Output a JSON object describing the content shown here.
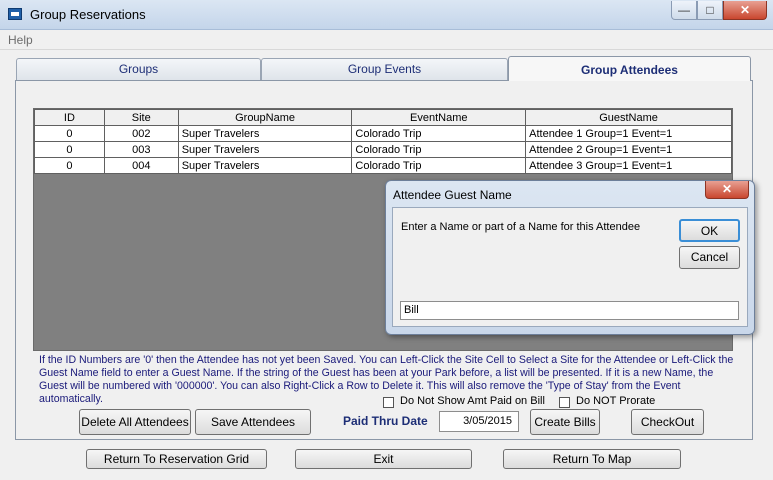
{
  "window": {
    "title": "Group Reservations"
  },
  "menu": {
    "help": "Help"
  },
  "tabs": [
    {
      "label": "Groups"
    },
    {
      "label": "Group Events"
    },
    {
      "label": "Group Attendees"
    }
  ],
  "grid": {
    "columns": [
      "ID",
      "Site",
      "GroupName",
      "EventName",
      "GuestName"
    ],
    "rows": [
      [
        "0",
        "002",
        "Super Travelers",
        "Colorado Trip",
        "Attendee 1 Group=1 Event=1"
      ],
      [
        "0",
        "003",
        "Super Travelers",
        "Colorado Trip",
        "Attendee 2 Group=1 Event=1"
      ],
      [
        "0",
        "004",
        "Super Travelers",
        "Colorado Trip",
        "Attendee 3 Group=1 Event=1"
      ]
    ]
  },
  "dialog": {
    "title": "Attendee Guest Name",
    "prompt": "Enter a Name or part of a Name for this Attendee",
    "ok_label": "OK",
    "cancel_label": "Cancel",
    "input_value": "Bill"
  },
  "info": {
    "text": "If the ID Numbers are '0' then the Attendee has not yet been Saved. You can Left-Click the Site Cell to Select a Site for the Attendee or Left-Click the Guest Name field to enter a Guest Name.  If the string of the Guest has been at your Park before, a list will be presented.  If it is a new Name, the Guest will be numbered with '000000'.  You can also Right-Click a Row to Delete it.  This will also remove the 'Type of Stay' from the Event automatically."
  },
  "options": {
    "no_amt_paid_label": "Do Not Show Amt Paid on Bill",
    "no_prorate_label": "Do NOT Prorate"
  },
  "actions": {
    "delete_all_label": "Delete All Attendees",
    "save_label": "Save Attendees",
    "paid_thru_label": "Paid Thru Date",
    "paid_thru_value": "3/05/2015",
    "create_bills_label": "Create Bills",
    "checkout_label": "CheckOut"
  },
  "footer": {
    "return_grid_label": "Return To Reservation Grid",
    "exit_label": "Exit",
    "return_map_label": "Return To Map"
  },
  "colors": {
    "accent": "#1d2e76",
    "grid_background": "#808080",
    "close_button": "#c9472f"
  }
}
